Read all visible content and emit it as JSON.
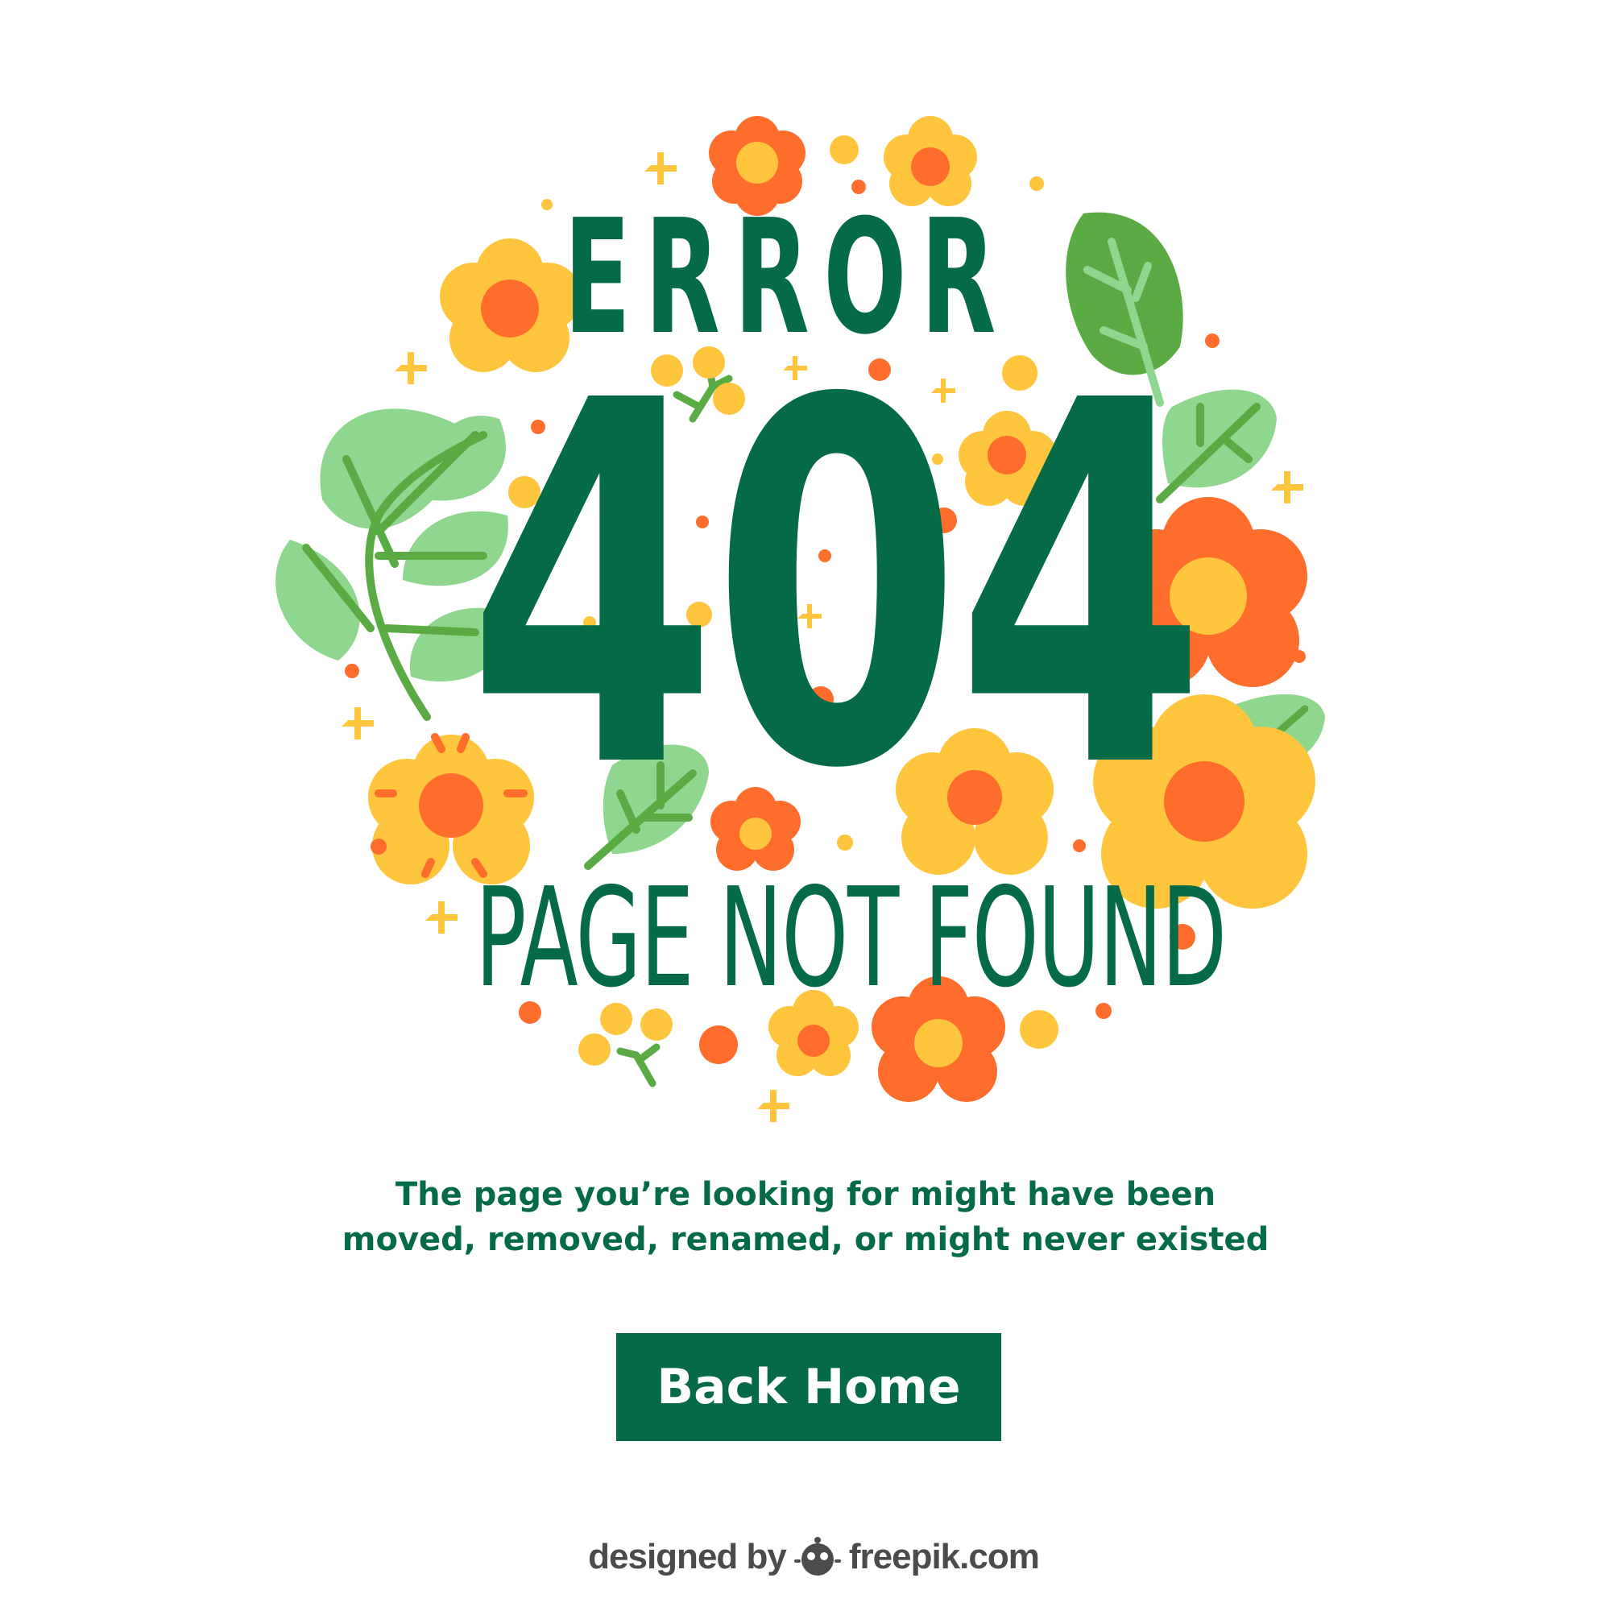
{
  "header": {
    "error_word": "ERROR",
    "code": "404",
    "subtitle": "PAGE NOT FOUND"
  },
  "message": {
    "line1": "The page you’re looking for might have been",
    "line2": "moved, removed, renamed, or might never existed"
  },
  "actions": {
    "back_home_label": "Back Home"
  },
  "credit": {
    "designed_by": "designed by",
    "brand": "freepik.com"
  },
  "colors": {
    "primary_green": "#056b47",
    "leaf_dark": "#5aab43",
    "leaf_light": "#8fd68f",
    "flower_yellow": "#ffc53d",
    "flower_orange": "#ff6d2d",
    "background": "#ffffff"
  },
  "icons": {
    "logo": "freepik-logo-icon",
    "decor": [
      "flower-icon",
      "leaf-icon",
      "sparkle-icon",
      "dot-icon"
    ]
  }
}
